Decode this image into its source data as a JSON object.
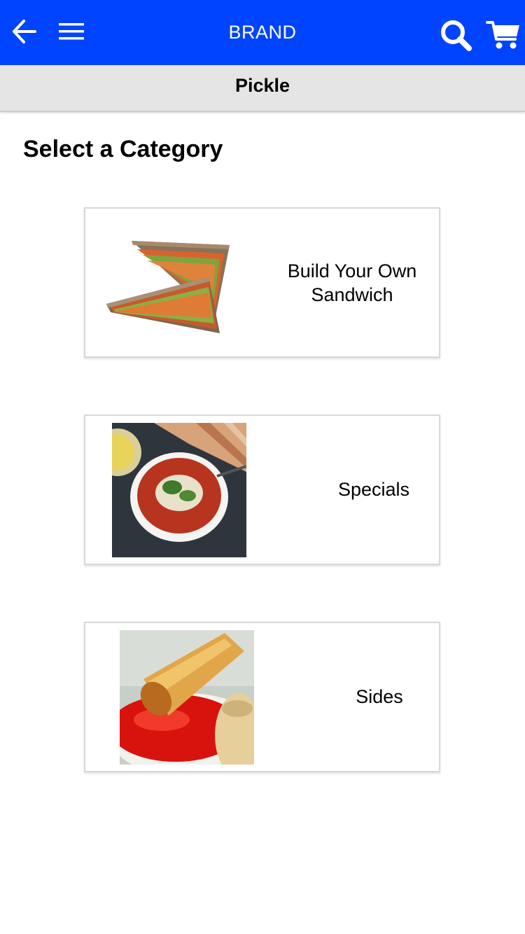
{
  "header": {
    "brand": "BRAND",
    "icons": {
      "back": "arrow-left-icon",
      "menu": "hamburger-menu-icon",
      "search": "search-icon",
      "cart": "shopping-cart-icon"
    },
    "background_color": "#0044ff"
  },
  "store": {
    "name": "Pickle"
  },
  "main": {
    "heading": "Select a Category",
    "categories": [
      {
        "label": "Build Your Own Sandwich",
        "image": "sandwich-photo"
      },
      {
        "label": "Specials",
        "image": "soup-bowl-photo"
      },
      {
        "label": "Sides",
        "image": "spring-roll-photo"
      }
    ]
  }
}
